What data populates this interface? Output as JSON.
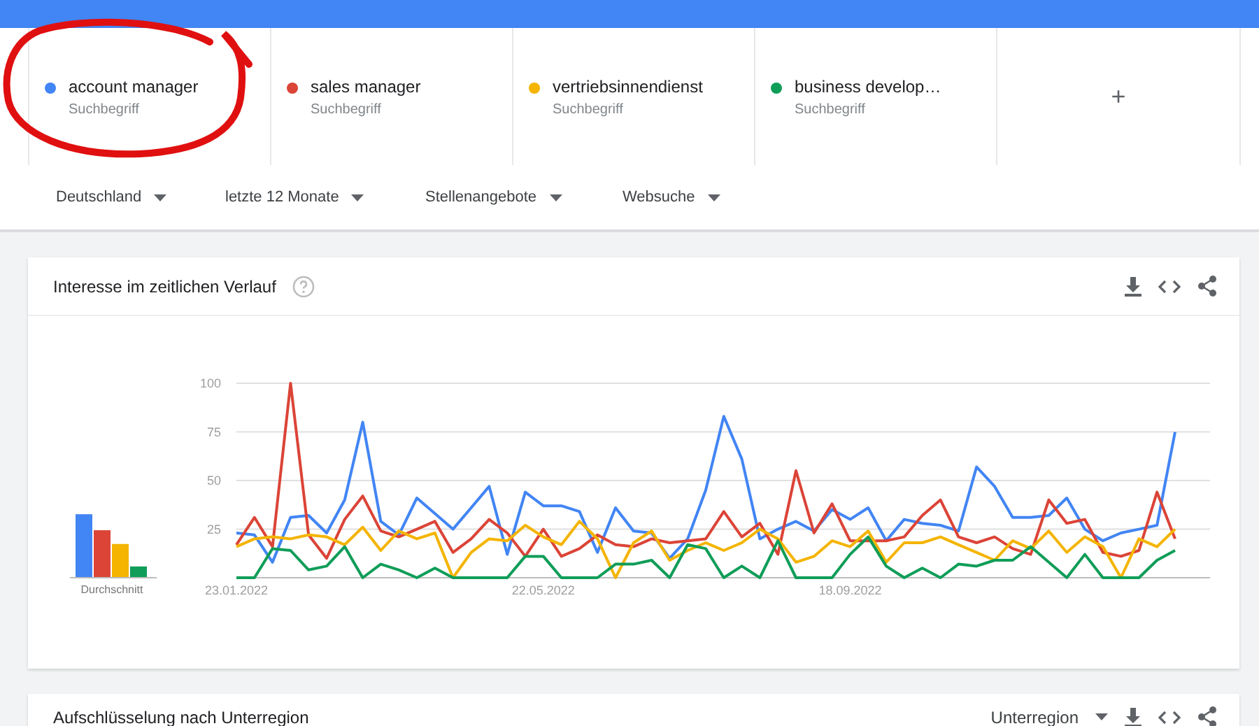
{
  "terms": [
    {
      "name": "account manager",
      "type": "Suchbegriff",
      "color": "#4285f4"
    },
    {
      "name": "sales manager",
      "type": "Suchbegriff",
      "color": "#db4437"
    },
    {
      "name": "vertriebsinnendienst",
      "type": "Suchbegriff",
      "color": "#f4b400"
    },
    {
      "name": "business develop…",
      "type": "Suchbegriff",
      "color": "#0f9d58"
    }
  ],
  "add_button": {
    "label": "+"
  },
  "filters": [
    {
      "label": "Deutschland"
    },
    {
      "label": "letzte 12 Monate"
    },
    {
      "label": "Stellenangebote"
    },
    {
      "label": "Websuche"
    }
  ],
  "interest_card": {
    "title": "Interesse im zeitlichen Verlauf",
    "average_label": "Durchschnitt",
    "chart_data": {
      "type": "line",
      "grid": true,
      "ylim": [
        0,
        100
      ],
      "yticks": [
        25,
        50,
        75,
        100
      ],
      "categories": [
        "23.01.2022",
        null,
        null,
        null,
        null,
        null,
        null,
        null,
        null,
        null,
        null,
        null,
        null,
        null,
        null,
        null,
        null,
        "22.05.2022",
        null,
        null,
        null,
        null,
        null,
        null,
        null,
        null,
        null,
        null,
        null,
        null,
        null,
        null,
        null,
        null,
        "18.09.2022",
        null,
        null,
        null,
        null,
        null,
        null,
        null,
        null,
        null,
        null,
        null,
        null,
        null,
        null,
        null,
        null,
        null,
        null
      ],
      "series": [
        {
          "color": "#4285f4",
          "values": [
            23,
            22,
            8,
            31,
            32,
            23,
            40,
            80,
            29,
            22,
            41,
            33,
            25,
            36,
            47,
            12,
            44,
            37,
            37,
            34,
            13,
            36,
            24,
            23,
            10,
            20,
            45,
            83,
            61,
            20,
            25,
            29,
            24,
            35,
            30,
            36,
            19,
            30,
            28,
            27,
            24,
            57,
            47,
            31,
            31,
            32,
            41,
            25,
            19,
            23,
            25,
            27,
            75
          ]
        },
        {
          "color": "#db4437",
          "values": [
            17,
            31,
            16,
            100,
            22,
            10,
            30,
            42,
            24,
            21,
            25,
            29,
            13,
            20,
            30,
            23,
            11,
            25,
            11,
            15,
            22,
            17,
            16,
            20,
            18,
            19,
            20,
            34,
            21,
            28,
            12,
            55,
            23,
            38,
            19,
            19,
            19,
            21,
            32,
            40,
            21,
            18,
            21,
            15,
            12,
            40,
            28,
            30,
            13,
            11,
            14,
            44,
            20
          ]
        },
        {
          "color": "#f4b400",
          "values": [
            16,
            20,
            21,
            20,
            22,
            21,
            17,
            26,
            14,
            24,
            20,
            23,
            0,
            13,
            20,
            19,
            27,
            21,
            17,
            29,
            20,
            0,
            18,
            24,
            9,
            14,
            18,
            14,
            18,
            25,
            20,
            8,
            11,
            19,
            16,
            24,
            8,
            18,
            18,
            21,
            17,
            13,
            9,
            19,
            15,
            24,
            13,
            21,
            16,
            0,
            20,
            16,
            25
          ]
        },
        {
          "color": "#0f9d58",
          "values": [
            0,
            0,
            15,
            14,
            4,
            6,
            16,
            0,
            7,
            4,
            0,
            5,
            0,
            0,
            0,
            0,
            11,
            11,
            0,
            0,
            0,
            7,
            7,
            9,
            0,
            17,
            15,
            0,
            6,
            0,
            19,
            0,
            0,
            0,
            12,
            21,
            6,
            0,
            5,
            0,
            7,
            6,
            9,
            9,
            16,
            8,
            0,
            12,
            0,
            0,
            0,
            9,
            14
          ]
        }
      ]
    }
  },
  "region_card": {
    "title": "Aufschlüsselung nach Unterregion",
    "dropdown": "Unterregion"
  },
  "annotation": {
    "kind": "ellipse"
  }
}
